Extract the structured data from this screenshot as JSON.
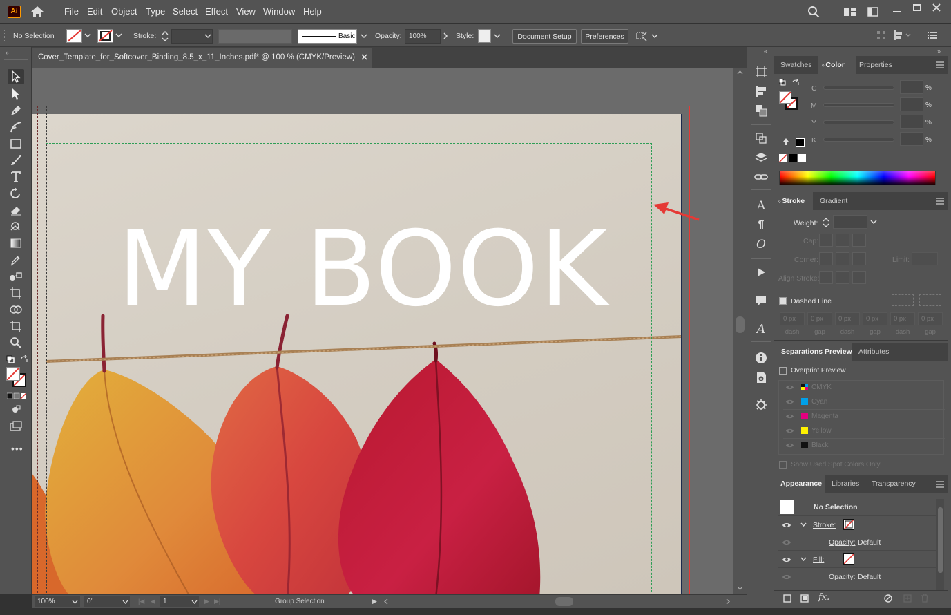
{
  "app": {
    "logo": "Ai"
  },
  "menu": [
    "File",
    "Edit",
    "Object",
    "Type",
    "Select",
    "Effect",
    "View",
    "Window",
    "Help"
  ],
  "control": {
    "selection": "No Selection",
    "stroke_label": "Stroke:",
    "brush_style": "Basic",
    "opacity_label": "Opacity:",
    "opacity_value": "100%",
    "style_label": "Style:",
    "document_setup": "Document Setup",
    "preferences": "Preferences"
  },
  "document": {
    "tab_title": "Cover_Template_for_Softcover_Binding_8.5_x_11_Inches.pdf* @ 100 % (CMYK/Preview)",
    "cover_title": "MY BOOK"
  },
  "status": {
    "zoom": "100%",
    "rotation": "0°",
    "artboard": "1",
    "tool": "Group Selection"
  },
  "color_panel": {
    "tabs": [
      "Swatches",
      "Color",
      "Properties"
    ],
    "active_tab": "Color",
    "channels": [
      "C",
      "M",
      "Y",
      "K"
    ],
    "unit": "%"
  },
  "stroke_panel": {
    "tabs": [
      "Stroke",
      "Gradient"
    ],
    "weight_label": "Weight:",
    "cap_label": "Cap:",
    "corner_label": "Corner:",
    "limit_label": "Limit:",
    "align_label": "Align Stroke:",
    "dashed_line_label": "Dashed Line",
    "dash_values": [
      "0 px",
      "0 px",
      "0 px",
      "0 px",
      "0 px",
      "0 px"
    ],
    "dash_labels": [
      "dash",
      "gap",
      "dash",
      "gap",
      "dash",
      "gap"
    ]
  },
  "separations_panel": {
    "tabs": [
      "Separations Preview",
      "Attributes"
    ],
    "overprint_label": "Overprint Preview",
    "inks": [
      {
        "name": "CMYK",
        "color": "#888888"
      },
      {
        "name": "Cyan",
        "color": "#00a0e9"
      },
      {
        "name": "Magenta",
        "color": "#e4007f"
      },
      {
        "name": "Yellow",
        "color": "#fff100"
      },
      {
        "name": "Black",
        "color": "#111111"
      }
    ],
    "spot_label": "Show Used Spot Colors Only"
  },
  "appearance_panel": {
    "tabs": [
      "Appearance",
      "Libraries",
      "Transparency"
    ],
    "title": "No Selection",
    "stroke_label": "Stroke:",
    "opacity_label": "Opacity:",
    "opacity_value": "Default",
    "fill_label": "Fill:",
    "fill_opacity_label": "Opacity:",
    "fill_opacity_value": "Default"
  },
  "colors": {
    "accent_red": "#e53935",
    "bleed_guide": "#e53935",
    "margin_guide": "#2e9e56",
    "page": "#d9d2c8",
    "ui_panel": "#535353"
  }
}
